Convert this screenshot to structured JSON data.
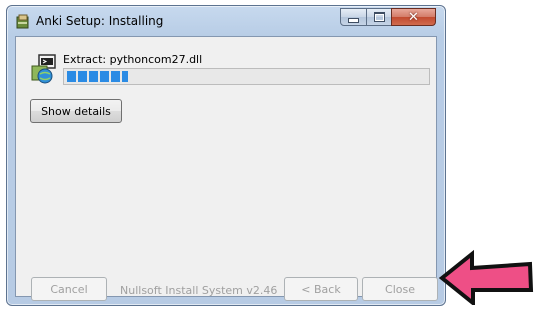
{
  "window": {
    "title": "Anki Setup: Installing",
    "close_glyph": "✕"
  },
  "install": {
    "status": "Extract: pythoncom27.dll",
    "progress_percent": 17
  },
  "buttons": {
    "show_details": "Show details",
    "cancel": "Cancel",
    "back": "< Back",
    "close": "Close"
  },
  "footer": {
    "branding": "Nullsoft Install System v2.46"
  },
  "colors": {
    "progress": "#2b8be4",
    "arrow": "#ee4f86"
  },
  "icons": {
    "app": "installer-package-icon",
    "installer": "installer-globe-icon",
    "annotation": "pointing-arrow-icon"
  }
}
